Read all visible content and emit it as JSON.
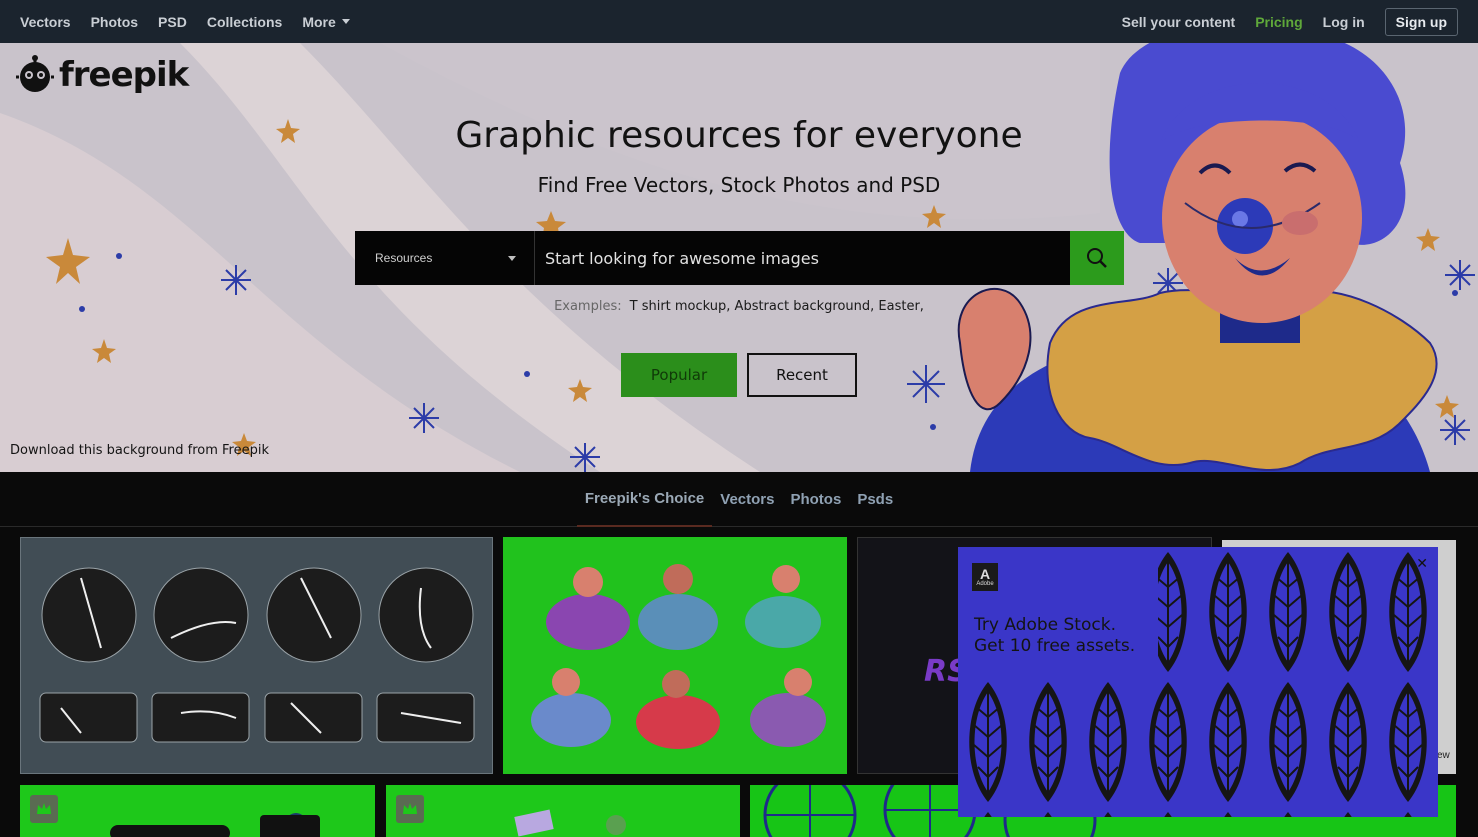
{
  "nav": {
    "left": [
      "Vectors",
      "Photos",
      "PSD",
      "Collections"
    ],
    "more": "More",
    "sell": "Sell your content",
    "pricing": "Pricing",
    "login": "Log in",
    "signup": "Sign up"
  },
  "brand": {
    "name": "freepik"
  },
  "hero": {
    "title": "Graphic resources for everyone",
    "subtitle": "Find Free Vectors, Stock Photos and PSD",
    "search": {
      "category": "Resources",
      "placeholder": "Start looking for awesome images"
    },
    "examples_label": "Examples:",
    "examples": "T shirt mockup, Abstract background, Easter,",
    "popular_label": "Popular",
    "recent_label": "Recent",
    "credit": "Download this background from Freepik"
  },
  "tabs": [
    "Freepik's Choice",
    "Vectors",
    "Photos",
    "Psds"
  ],
  "ad": {
    "brand": "Adobe",
    "line1": "Try Adobe Stock.",
    "line2": "Get 10 free assets."
  },
  "tile3_text": "RS",
  "tile4_text": "ew",
  "colors": {
    "nav_bg": "#1b242e",
    "accent_green": "#2c9b1c",
    "pricing_green": "#5fa83a",
    "ad_bg": "#3a36c8"
  }
}
